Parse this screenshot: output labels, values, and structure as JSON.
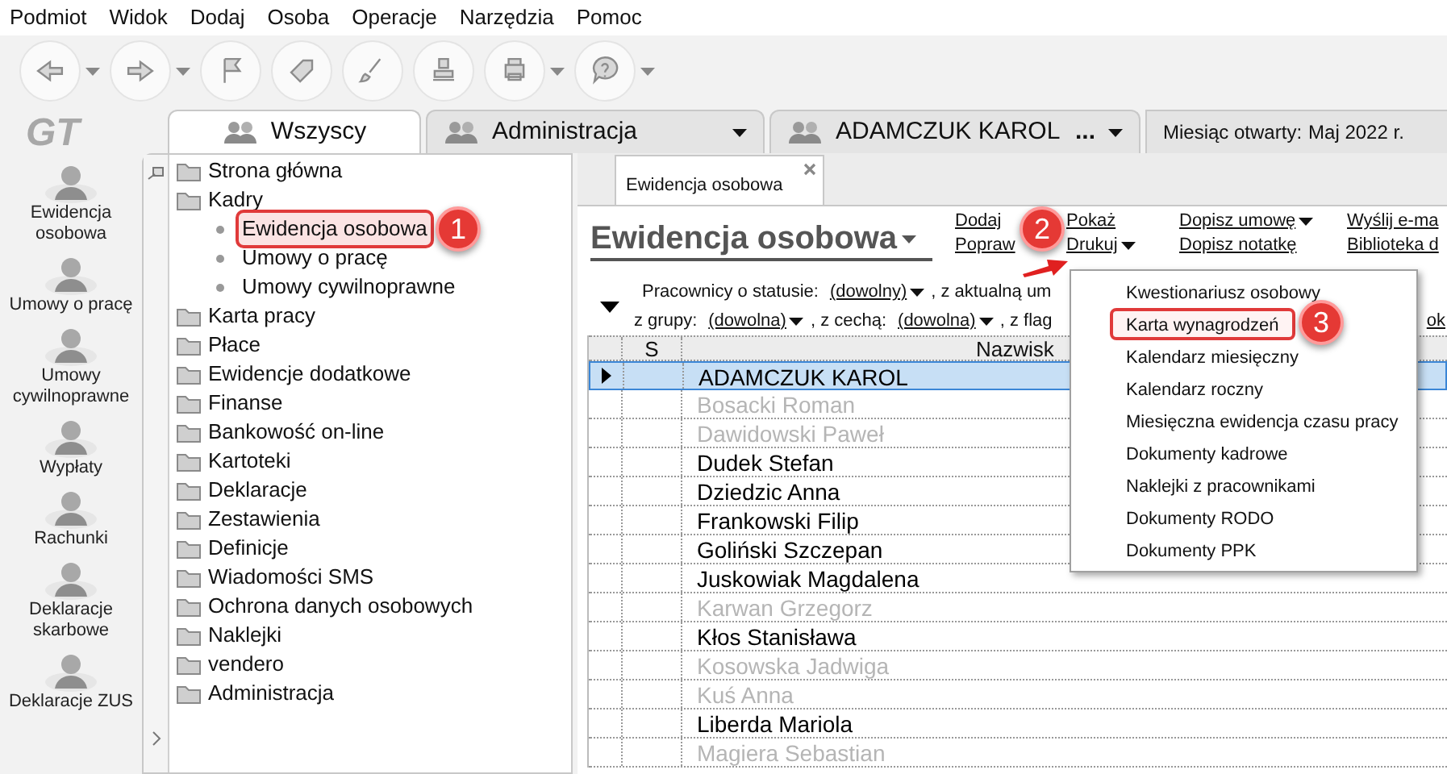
{
  "menu_bar": [
    "Podmiot",
    "Widok",
    "Dodaj",
    "Osoba",
    "Operacje",
    "Narzędzia",
    "Pomoc"
  ],
  "toolbar": [
    {
      "kind": "back",
      "dropdown": true
    },
    {
      "kind": "forward",
      "dropdown": true
    },
    {
      "kind": "flag",
      "dropdown": false
    },
    {
      "kind": "tag",
      "dropdown": false
    },
    {
      "kind": "brush",
      "dropdown": false
    },
    {
      "kind": "stamp",
      "dropdown": false
    },
    {
      "kind": "printer",
      "dropdown": true
    },
    {
      "kind": "help",
      "dropdown": true
    }
  ],
  "logo": "GT",
  "nav": [
    "Ewidencja osobowa",
    "Umowy o pracę",
    "Umowy cywilnoprawne",
    "Wypłaty",
    "Rachunki",
    "Deklaracje skarbowe",
    "Deklaracje ZUS"
  ],
  "context_tabs": [
    {
      "label": "Wszyscy",
      "selected": true,
      "dropdown": false
    },
    {
      "label": "Administracja",
      "selected": false,
      "dropdown": true
    },
    {
      "label": "ADAMCZUK KAROL",
      "selected": false,
      "dropdown": true,
      "extra": "..."
    }
  ],
  "month": {
    "label": "Miesiąc otwarty:",
    "value": "Maj 2022 r."
  },
  "tree": [
    {
      "label": "Strona główna"
    },
    {
      "label": "Kadry",
      "children": [
        {
          "label": "Ewidencja osobowa",
          "selected": true
        },
        {
          "label": "Umowy o pracę",
          "selected": false
        },
        {
          "label": "Umowy cywilnoprawne",
          "selected": false
        }
      ]
    },
    {
      "label": "Karta pracy"
    },
    {
      "label": "Płace"
    },
    {
      "label": "Ewidencje dodatkowe"
    },
    {
      "label": "Finanse"
    },
    {
      "label": "Bankowość on-line"
    },
    {
      "label": "Kartoteki"
    },
    {
      "label": "Deklaracje"
    },
    {
      "label": "Zestawienia"
    },
    {
      "label": "Definicje"
    },
    {
      "label": "Wiadomości SMS"
    },
    {
      "label": "Ochrona danych osobowych"
    },
    {
      "label": "Naklejki"
    },
    {
      "label": "vendero"
    },
    {
      "label": "Administracja"
    }
  ],
  "doc_tab": {
    "label": "Ewidencja osobowa"
  },
  "title": "Ewidencja osobowa",
  "actions": [
    [
      {
        "label": "Dodaj",
        "dropdown": false
      },
      {
        "label": "Popraw",
        "dropdown": false
      }
    ],
    [
      {
        "label": "Pokaż",
        "dropdown": false
      },
      {
        "label": "Drukuj",
        "dropdown": true
      }
    ],
    [
      {
        "label": "Dopisz umowę",
        "dropdown": true
      },
      {
        "label": "Dopisz notatkę",
        "dropdown": false
      }
    ],
    [
      {
        "label": "Wyślij e-ma",
        "dropdown": false
      },
      {
        "label": "Biblioteka d",
        "dropdown": false
      }
    ]
  ],
  "filters": [
    [
      {
        "kind": "text",
        "text": "Pracownicy o statusie:"
      },
      {
        "kind": "select",
        "text": "(dowolny)"
      },
      {
        "kind": "text",
        "text": ", z aktualną um"
      }
    ],
    [
      {
        "kind": "text",
        "text": "z grupy:"
      },
      {
        "kind": "select",
        "text": "(dowolna)"
      },
      {
        "kind": "text",
        "text": ", z cechą:"
      },
      {
        "kind": "select",
        "text": "(dowolna)"
      },
      {
        "kind": "text",
        "text": ", z flag"
      }
    ]
  ],
  "filter_link": "ok",
  "table": {
    "columns": [
      "S",
      "Nazwisk"
    ],
    "rows": [
      {
        "name": "ADAMCZUK KAROL",
        "selected": true,
        "inactive": false
      },
      {
        "name": "Bosacki Roman",
        "selected": false,
        "inactive": true
      },
      {
        "name": "Dawidowski Paweł",
        "selected": false,
        "inactive": true
      },
      {
        "name": "Dudek Stefan",
        "selected": false,
        "inactive": false
      },
      {
        "name": "Dziedzic Anna",
        "selected": false,
        "inactive": false
      },
      {
        "name": "Frankowski Filip",
        "selected": false,
        "inactive": false
      },
      {
        "name": "Goliński Szczepan",
        "selected": false,
        "inactive": false
      },
      {
        "name": "Juskowiak Magdalena",
        "selected": false,
        "inactive": false
      },
      {
        "name": "Karwan Grzegorz",
        "selected": false,
        "inactive": true
      },
      {
        "name": "Kłos Stanisława",
        "selected": false,
        "inactive": false
      },
      {
        "name": "Kosowska Jadwiga",
        "selected": false,
        "inactive": true
      },
      {
        "name": "Kuś Anna",
        "selected": false,
        "inactive": true
      },
      {
        "name": "Liberda Mariola",
        "selected": false,
        "inactive": false
      },
      {
        "name": "Magiera Sebastian",
        "selected": false,
        "inactive": true
      }
    ]
  },
  "print_menu": [
    {
      "label": "Kwestionariusz osobowy",
      "highlighted": false
    },
    {
      "label": "Karta wynagrodzeń",
      "highlighted": true
    },
    {
      "label": "Kalendarz miesięczny",
      "highlighted": false
    },
    {
      "label": "Kalendarz roczny",
      "highlighted": false
    },
    {
      "label": "Miesięczna ewidencja czasu pracy",
      "highlighted": false
    },
    {
      "label": "Dokumenty kadrowe",
      "highlighted": false
    },
    {
      "label": "Naklejki z pracownikami",
      "highlighted": false
    },
    {
      "label": "Dokumenty RODO",
      "highlighted": false
    },
    {
      "label": "Dokumenty PPK",
      "highlighted": false
    }
  ],
  "callouts": [
    {
      "label": "1"
    },
    {
      "label": "2"
    },
    {
      "label": "3"
    }
  ]
}
